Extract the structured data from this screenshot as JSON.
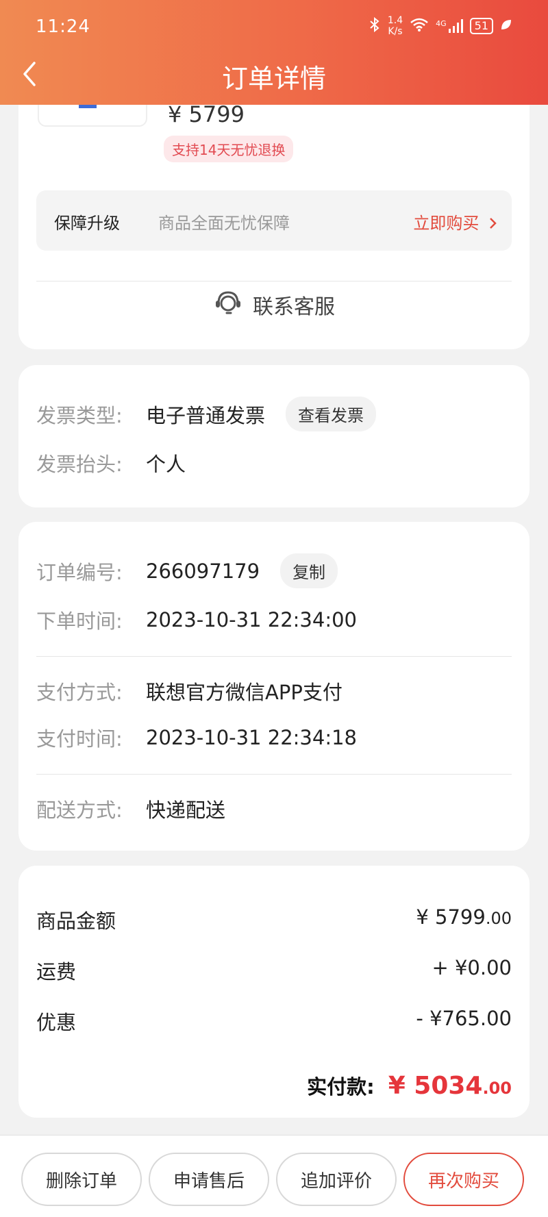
{
  "status": {
    "time": "11:24",
    "net_speed_value": "1.4",
    "net_speed_unit": "K/s",
    "signal": "4G",
    "battery": "51"
  },
  "header": {
    "title": "订单详情"
  },
  "product": {
    "price": "¥ 5799",
    "return_badge": "支持14天无忧退换",
    "guarantee_label": "保障升级",
    "guarantee_desc": "商品全面无忧保障",
    "guarantee_link": "立即购买",
    "service": "联系客服"
  },
  "invoice": {
    "type_label": "发票类型:",
    "type_value": "电子普通发票",
    "view_button": "查看发票",
    "header_label": "发票抬头:",
    "header_value": "个人"
  },
  "order": {
    "number_label": "订单编号:",
    "number_value": "266097179",
    "copy_button": "复制",
    "order_time_label": "下单时间:",
    "order_time_value": "2023-10-31 22:34:00",
    "pay_method_label": "支付方式:",
    "pay_method_value": "联想官方微信APP支付",
    "pay_time_label": "支付时间:",
    "pay_time_value": "2023-10-31 22:34:18",
    "delivery_label": "配送方式:",
    "delivery_value": "快递配送"
  },
  "summary": {
    "goods_label": "商品金额",
    "goods_value": "¥ 5799",
    "goods_cents": ".00",
    "shipping_label": "运费",
    "shipping_value": "+ ¥0.00",
    "discount_label": "优惠",
    "discount_value": "- ¥765.00",
    "total_label": "实付款:",
    "total_value": "¥ 5034",
    "total_cents": ".00"
  },
  "actions": {
    "delete": "删除订单",
    "after_sale": "申请售后",
    "review": "追加评价",
    "rebuy": "再次购买"
  },
  "colors": {
    "accent": "#e24b3d",
    "price_red": "#e5353b",
    "header_start": "#f08a52",
    "header_end": "#e94a3e"
  }
}
